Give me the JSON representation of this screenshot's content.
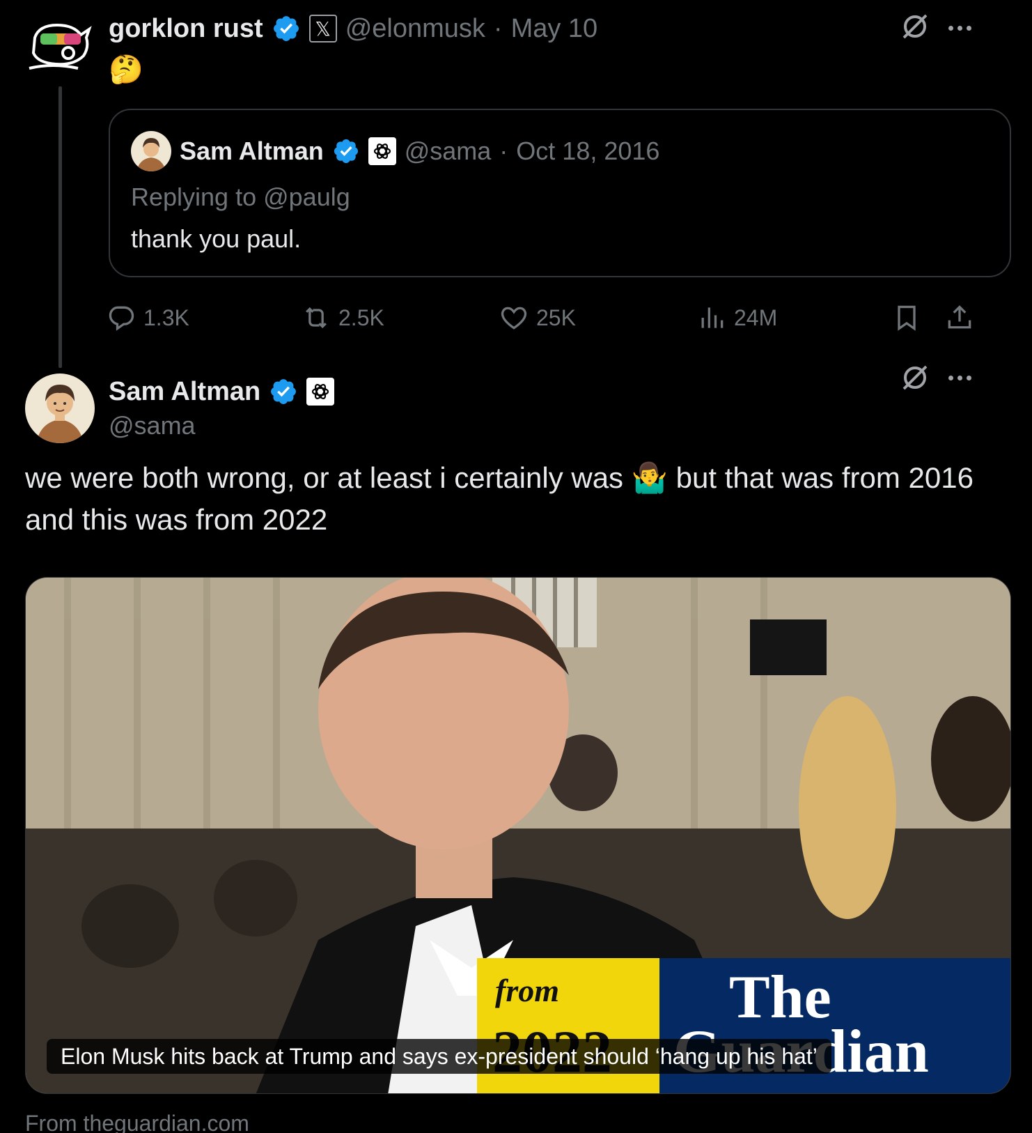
{
  "post1": {
    "author_name": "gorklon rust",
    "handle": "@elonmusk",
    "separator": "·",
    "date": "May 10",
    "emoji": "🤔",
    "quote": {
      "author_name": "Sam Altman",
      "handle": "@sama",
      "separator": "·",
      "date": "Oct 18, 2016",
      "replying_to": "Replying to @paulg",
      "text": "thank you paul."
    },
    "actions": {
      "replies": "1.3K",
      "reposts": "2.5K",
      "likes": "25K",
      "views": "24M"
    }
  },
  "post2": {
    "author_name": "Sam Altman",
    "handle": "@sama",
    "text": "we were both wrong, or at least i certainly was 🤷‍♂️ but that was from 2016 and this was from 2022",
    "media": {
      "badge_from": "from",
      "badge_year": "2022",
      "badge_brand_line1": "The",
      "badge_brand_line2": "Guardian",
      "caption": "Elon Musk hits back at Trump and says ex-president should ‘hang up his hat’"
    },
    "source": "From theguardian.com"
  },
  "icons": {
    "verified": "verified-badge-icon",
    "grok": "grok-icon",
    "more": "more-icon",
    "reply": "reply-icon",
    "repost": "repost-icon",
    "like": "like-icon",
    "views": "views-icon",
    "bookmark": "bookmark-icon",
    "share": "share-icon"
  },
  "colors": {
    "background": "#000000",
    "text": "#e7e9ea",
    "muted": "#71767b",
    "verified": "#1d9bf0",
    "border": "#333639",
    "badge_yellow": "#f0d60a",
    "guardian_blue": "#052962"
  }
}
